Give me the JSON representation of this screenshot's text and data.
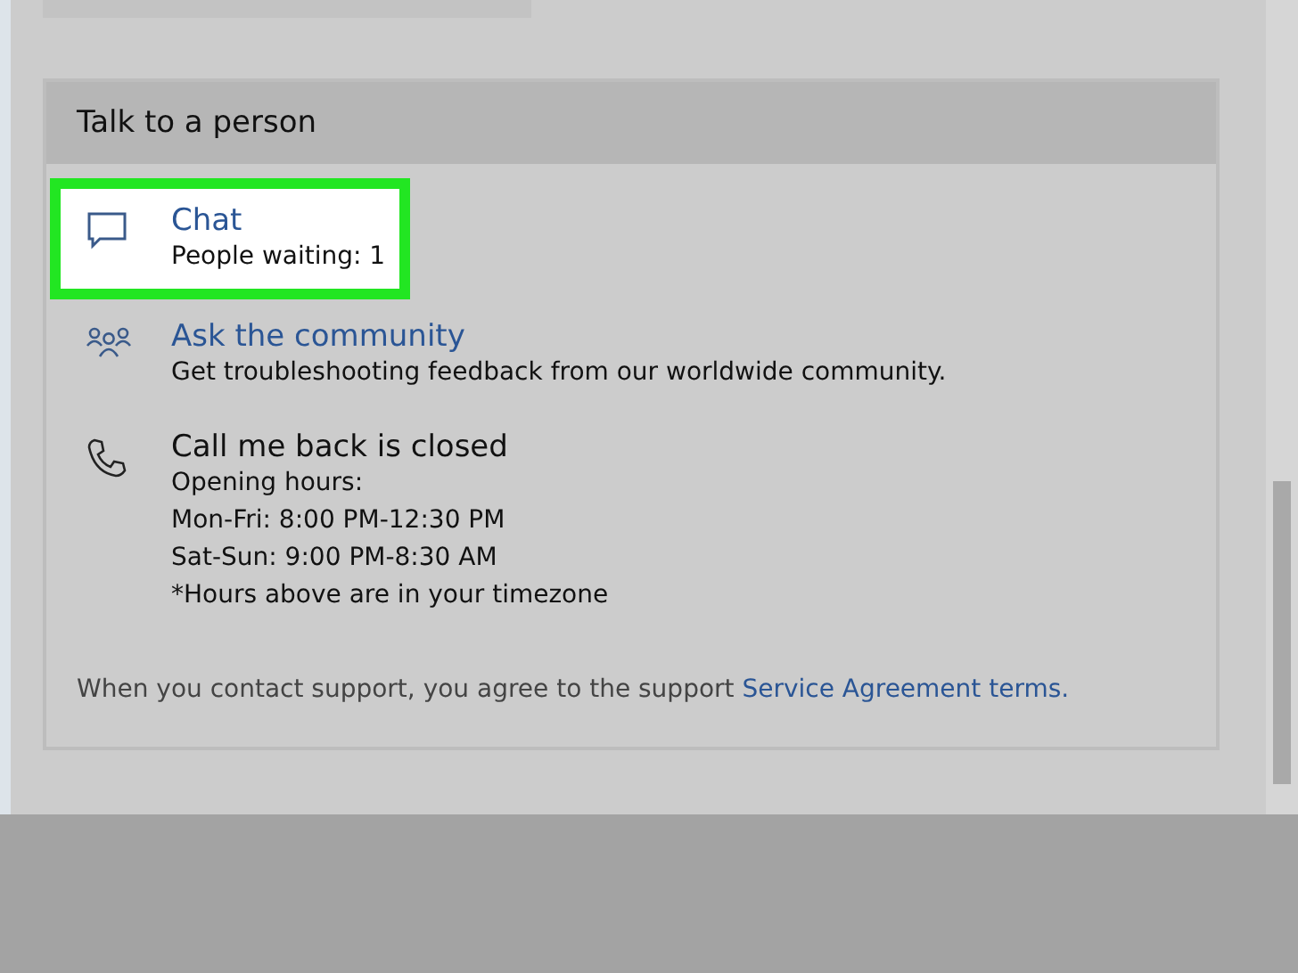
{
  "section": {
    "title": "Talk to a person",
    "options": [
      {
        "kind": "chat",
        "title": "Chat",
        "link": true,
        "highlighted": true,
        "lines": [
          "People waiting: 1"
        ]
      },
      {
        "kind": "community",
        "title": "Ask the community",
        "link": true,
        "highlighted": false,
        "lines": [
          "Get troubleshooting feedback from our worldwide community."
        ]
      },
      {
        "kind": "phone",
        "title": "Call me back is closed",
        "link": false,
        "highlighted": false,
        "lines": [
          "Opening hours:",
          "Mon-Fri: 8:00 PM-12:30 PM",
          "Sat-Sun: 9:00 PM-8:30 AM",
          "*Hours above are in your timezone"
        ]
      }
    ],
    "footer": {
      "text": "When you contact support, you agree to the support",
      "link": "Service Agreement terms."
    }
  }
}
